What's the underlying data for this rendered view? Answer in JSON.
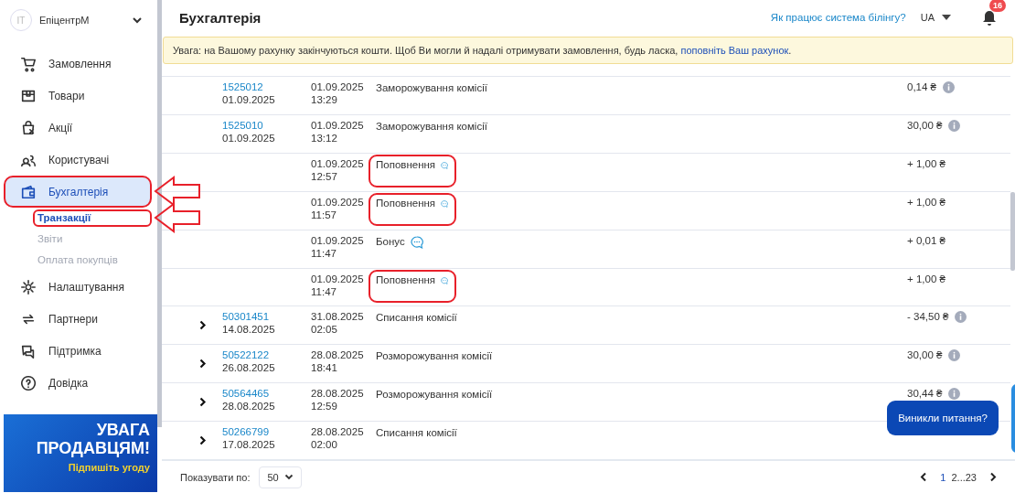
{
  "sidebar": {
    "account": {
      "initials": "IT",
      "name": "ЕпіцентрМ"
    },
    "items": [
      {
        "label": "Замовлення",
        "selected": false,
        "highlighted": false
      },
      {
        "label": "Товари",
        "selected": false,
        "highlighted": false
      },
      {
        "label": "Акції",
        "selected": false,
        "highlighted": false
      },
      {
        "label": "Користувачі",
        "selected": false,
        "highlighted": false
      },
      {
        "label": "Бухгалтерія",
        "selected": true,
        "highlighted": true,
        "children": [
          {
            "label": "Транзакції",
            "selected": true,
            "highlighted": true
          },
          {
            "label": "Звіти",
            "selected": false,
            "highlighted": false
          },
          {
            "label": "Оплата покупців",
            "selected": false,
            "highlighted": false
          }
        ]
      },
      {
        "label": "Налаштування",
        "selected": false,
        "highlighted": false
      },
      {
        "label": "Партнери",
        "selected": false,
        "highlighted": false
      },
      {
        "label": "Підтримка",
        "selected": false,
        "highlighted": false
      },
      {
        "label": "Довідка",
        "selected": false,
        "highlighted": false
      }
    ],
    "promo": {
      "title": "УВАГА ПРОДАВЦЯМ!",
      "subtitle": "Підпишіть угоду"
    }
  },
  "header": {
    "title": "Бухгалтерія",
    "billing_link": "Як працює система білінгу?",
    "language": "UA",
    "notifications": "16"
  },
  "notice": {
    "text": "Увага: на Вашому рахунку закінчуються кошти. Щоб Ви могли й надалі отримувати замовлення, будь ласка, ",
    "link": "поповніть Ваш рахунок",
    "end": "."
  },
  "table": {
    "rows": [
      {
        "expandable": false,
        "order": "1525012",
        "order_date": "01.09.2025",
        "date": "01.09.2025",
        "time": "13:29",
        "type": "Заморожування комісії",
        "comment": false,
        "highlighted": false,
        "amount": "0,14 ₴",
        "info": true
      },
      {
        "expandable": false,
        "order": "1525010",
        "order_date": "01.09.2025",
        "date": "01.09.2025",
        "time": "13:12",
        "type": "Заморожування комісії",
        "comment": false,
        "highlighted": false,
        "amount": "30,00 ₴",
        "info": true
      },
      {
        "expandable": false,
        "date": "01.09.2025",
        "time": "12:57",
        "type": "Поповнення",
        "comment": true,
        "highlighted": true,
        "amount": "+ 1,00 ₴",
        "info": false
      },
      {
        "expandable": false,
        "date": "01.09.2025",
        "time": "11:57",
        "type": "Поповнення",
        "comment": true,
        "highlighted": true,
        "amount": "+ 1,00 ₴",
        "info": false
      },
      {
        "expandable": false,
        "date": "01.09.2025",
        "time": "11:47",
        "type": "Бонус",
        "comment": true,
        "highlighted": false,
        "amount": "+ 0,01 ₴",
        "info": false
      },
      {
        "expandable": false,
        "date": "01.09.2025",
        "time": "11:47",
        "type": "Поповнення",
        "comment": true,
        "highlighted": true,
        "amount": "+ 1,00 ₴",
        "info": false
      },
      {
        "expandable": true,
        "order": "50301451",
        "order_date": "14.08.2025",
        "date": "31.08.2025",
        "time": "02:05",
        "type": "Списання комісії",
        "comment": false,
        "highlighted": false,
        "amount": "- 34,50 ₴",
        "info": true
      },
      {
        "expandable": true,
        "order": "50522122",
        "order_date": "26.08.2025",
        "date": "28.08.2025",
        "time": "18:41",
        "type": "Розморожування комісії",
        "comment": false,
        "highlighted": false,
        "amount": "30,00 ₴",
        "info": true
      },
      {
        "expandable": true,
        "order": "50564465",
        "order_date": "28.08.2025",
        "date": "28.08.2025",
        "time": "12:59",
        "type": "Розморожування комісії",
        "comment": false,
        "highlighted": false,
        "amount": "30,44 ₴",
        "info": true
      },
      {
        "expandable": true,
        "order": "50266799",
        "order_date": "17.08.2025",
        "date": "28.08.2025",
        "time": "02:00",
        "type": "Списання комісії",
        "comment": false,
        "highlighted": false
      }
    ]
  },
  "footer": {
    "page_size_label": "Показувати по:",
    "page_size": "50",
    "pages": [
      {
        "label": "1",
        "selected": true
      },
      {
        "label": "2...23",
        "selected": false
      }
    ]
  },
  "chat_button": "Виникли питання?"
}
